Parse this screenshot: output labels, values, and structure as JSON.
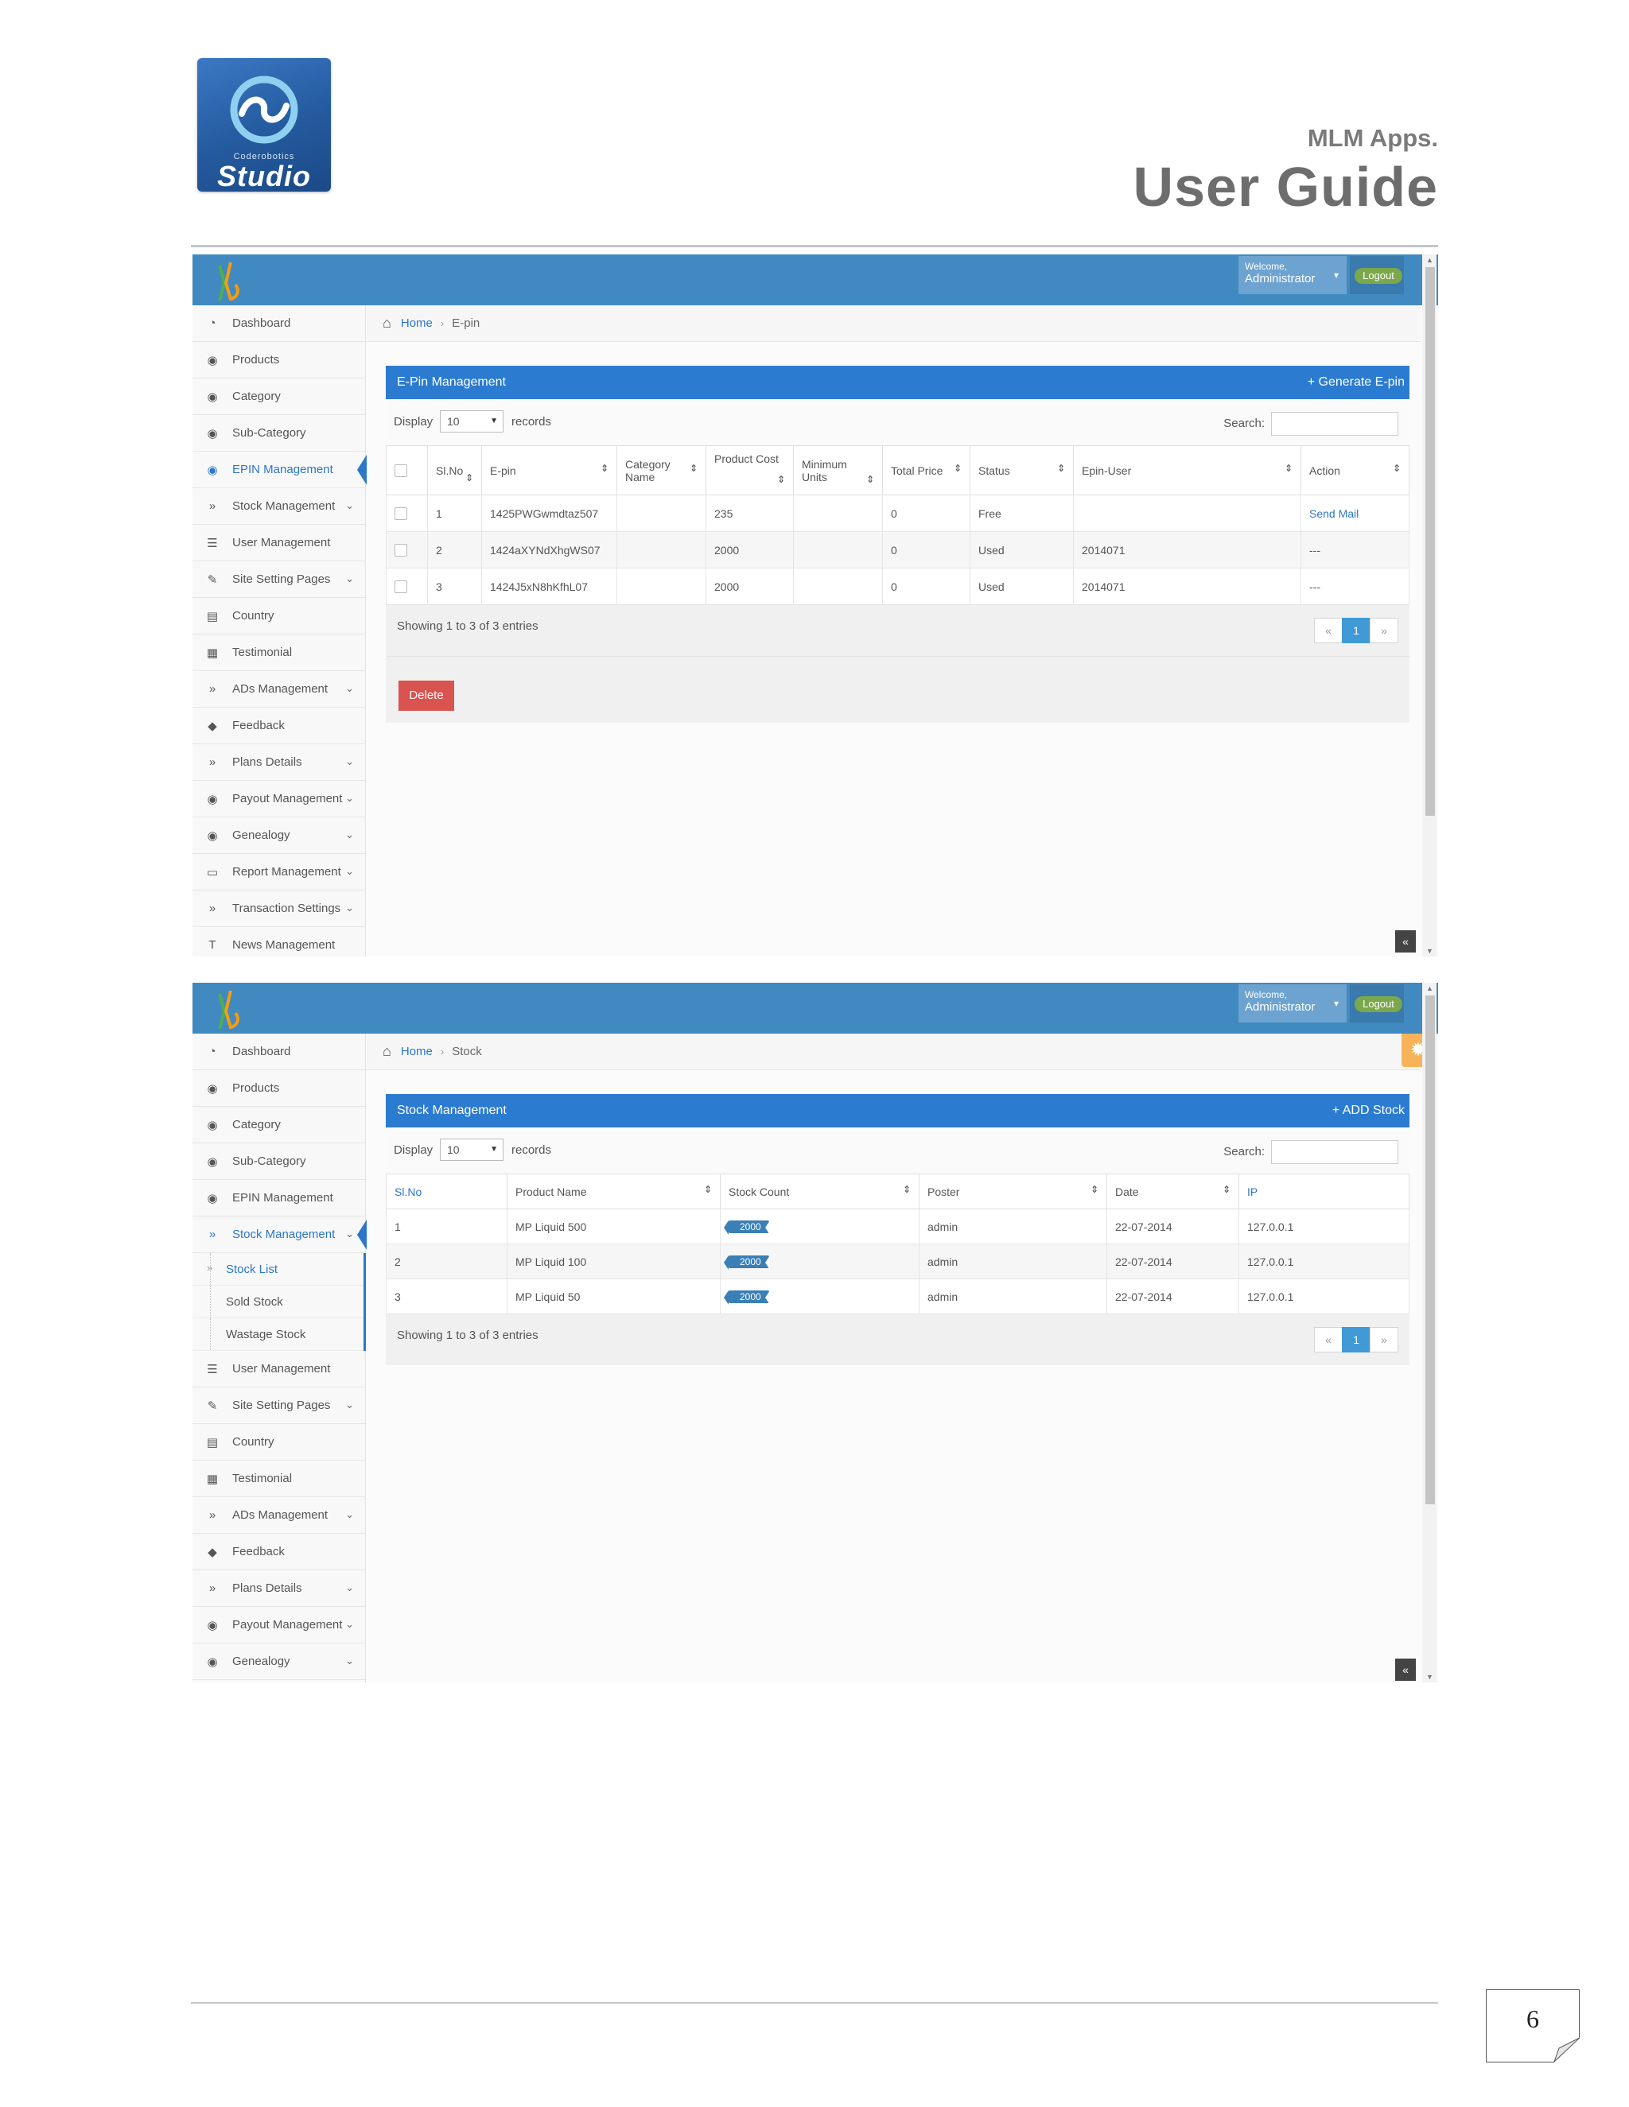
{
  "header": {
    "logo_small": "Coderobotics",
    "logo_text": "Studio",
    "subtitle": "MLM Apps.",
    "title": "User Guide"
  },
  "app": {
    "welcome": "Welcome,",
    "user": "Administrator",
    "logout": "Logout",
    "record_label": "records",
    "display_label": "Display",
    "display_value": "10",
    "search_label": "Search:",
    "home_label": "Home"
  },
  "shot1": {
    "sidebar": [
      {
        "label": "Dashboard",
        "icon": "dashboard-icon"
      },
      {
        "label": "Products",
        "icon": "eye-icon"
      },
      {
        "label": "Category",
        "icon": "eye-icon"
      },
      {
        "label": "Sub-Category",
        "icon": "eye-icon"
      },
      {
        "label": "EPIN Management",
        "icon": "eye-icon",
        "active": true
      },
      {
        "label": "Stock Management",
        "icon": "double-chevron-icon",
        "chevron": true
      },
      {
        "label": "User Management",
        "icon": "list-icon"
      },
      {
        "label": "Site Setting Pages",
        "icon": "edit-icon",
        "chevron": true
      },
      {
        "label": "Country",
        "icon": "id-card-icon"
      },
      {
        "label": "Testimonial",
        "icon": "calendar-icon"
      },
      {
        "label": "ADs Management",
        "icon": "double-chevron-icon",
        "chevron": true
      },
      {
        "label": "Feedback",
        "icon": "tag-icon"
      },
      {
        "label": "Plans Details",
        "icon": "double-chevron-icon",
        "chevron": true
      },
      {
        "label": "Payout Management",
        "icon": "eye-icon",
        "chevron": true
      },
      {
        "label": "Genealogy",
        "icon": "eye-icon",
        "chevron": true
      },
      {
        "label": "Report Management",
        "icon": "monitor-icon",
        "chevron": true
      },
      {
        "label": "Transaction Settings",
        "icon": "double-chevron-icon",
        "chevron": true
      },
      {
        "label": "News Management",
        "icon": "text-icon"
      }
    ],
    "breadcrumb_current": "E-pin",
    "panel_title": "E-Pin Management",
    "panel_action": "+ Generate E-pin",
    "columns": [
      "Sl.No",
      "E-pin",
      "Category Name",
      "Product Cost",
      "Minimum Units",
      "Total Price",
      "Status",
      "Epin-User",
      "Action"
    ],
    "rows": [
      {
        "sl": "1",
        "epin": "1425PWGwmdtaz507",
        "category": "",
        "cost": "235",
        "min": "",
        "total": "0",
        "status": "Free",
        "user": "",
        "action": "Send Mail"
      },
      {
        "sl": "2",
        "epin": "1424aXYNdXhgWS07",
        "category": "",
        "cost": "2000",
        "min": "",
        "total": "0",
        "status": "Used",
        "user": "2014071",
        "action": "---"
      },
      {
        "sl": "3",
        "epin": "1424J5xN8hKfhL07",
        "category": "",
        "cost": "2000",
        "min": "",
        "total": "0",
        "status": "Used",
        "user": "2014071",
        "action": "---"
      }
    ],
    "info": "Showing 1 to 3 of 3 entries",
    "pager": [
      "«",
      "1",
      "»"
    ],
    "delete_label": "Delete"
  },
  "shot2": {
    "sidebar_top": [
      {
        "label": "Dashboard",
        "icon": "dashboard-icon"
      },
      {
        "label": "Products",
        "icon": "eye-icon"
      },
      {
        "label": "Category",
        "icon": "eye-icon"
      },
      {
        "label": "Sub-Category",
        "icon": "eye-icon"
      },
      {
        "label": "EPIN Management",
        "icon": "eye-icon"
      },
      {
        "label": "Stock Management",
        "icon": "double-chevron-icon",
        "chevron": true,
        "active": true
      }
    ],
    "sub_items": [
      {
        "label": "Stock List",
        "active": true
      },
      {
        "label": "Sold Stock"
      },
      {
        "label": "Wastage Stock"
      }
    ],
    "sidebar_bottom": [
      {
        "label": "User Management",
        "icon": "list-icon"
      },
      {
        "label": "Site Setting Pages",
        "icon": "edit-icon",
        "chevron": true
      },
      {
        "label": "Country",
        "icon": "id-card-icon"
      },
      {
        "label": "Testimonial",
        "icon": "calendar-icon"
      },
      {
        "label": "ADs Management",
        "icon": "double-chevron-icon",
        "chevron": true
      },
      {
        "label": "Feedback",
        "icon": "tag-icon"
      },
      {
        "label": "Plans Details",
        "icon": "double-chevron-icon",
        "chevron": true
      },
      {
        "label": "Payout Management",
        "icon": "eye-icon",
        "chevron": true
      },
      {
        "label": "Genealogy",
        "icon": "eye-icon",
        "chevron": true
      }
    ],
    "breadcrumb_current": "Stock",
    "panel_title": "Stock Management",
    "panel_action": "+ ADD Stock",
    "columns": [
      "Sl.No",
      "Product Name",
      "Stock Count",
      "Poster",
      "Date",
      "IP"
    ],
    "rows": [
      {
        "sl": "1",
        "product": "MP Liquid 500",
        "count": "2000",
        "poster": "admin",
        "date": "22-07-2014",
        "ip": "127.0.0.1"
      },
      {
        "sl": "2",
        "product": "MP Liquid 100",
        "count": "2000",
        "poster": "admin",
        "date": "22-07-2014",
        "ip": "127.0.0.1"
      },
      {
        "sl": "3",
        "product": "MP Liquid 50",
        "count": "2000",
        "poster": "admin",
        "date": "22-07-2014",
        "ip": "127.0.0.1"
      }
    ],
    "info": "Showing 1 to 3 of 3 entries",
    "pager": [
      "«",
      "1",
      "»"
    ]
  },
  "page_number": "6"
}
